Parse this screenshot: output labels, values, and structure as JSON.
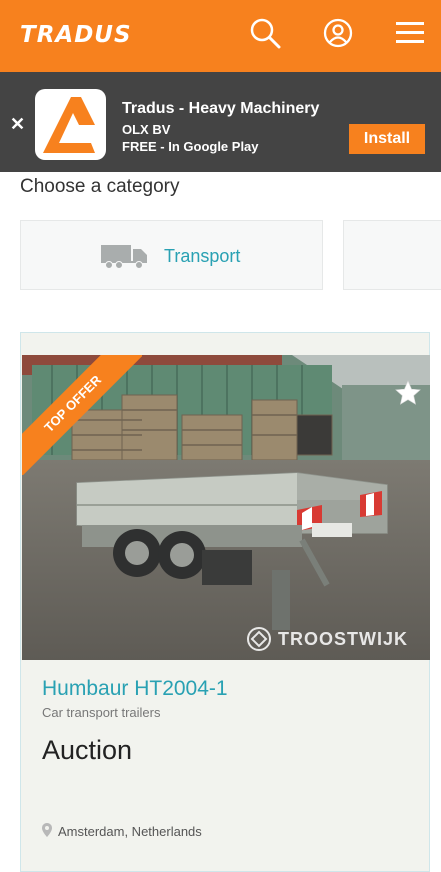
{
  "header": {
    "logo": "TRADUS",
    "background_color": "#f7811e",
    "icons": [
      "search-icon",
      "user-icon",
      "menu-icon"
    ]
  },
  "app_banner": {
    "close_label": "✕",
    "title": "Tradus - Heavy Machinery",
    "publisher": "OLX BV",
    "price_store": "FREE - In Google Play",
    "install_label": "Install"
  },
  "categories": {
    "heading": "Choose a category",
    "items": [
      {
        "label": "Transport",
        "icon": "truck-icon"
      }
    ]
  },
  "listing": {
    "ribbon": "TOP OFFER",
    "watermark": "TROOSTWIJK",
    "title": "Humbaur HT2004-1",
    "category": "Car transport trailers",
    "price": "Auction",
    "location": "Amsterdam, Netherlands",
    "accent_color": "#29a1b3"
  }
}
